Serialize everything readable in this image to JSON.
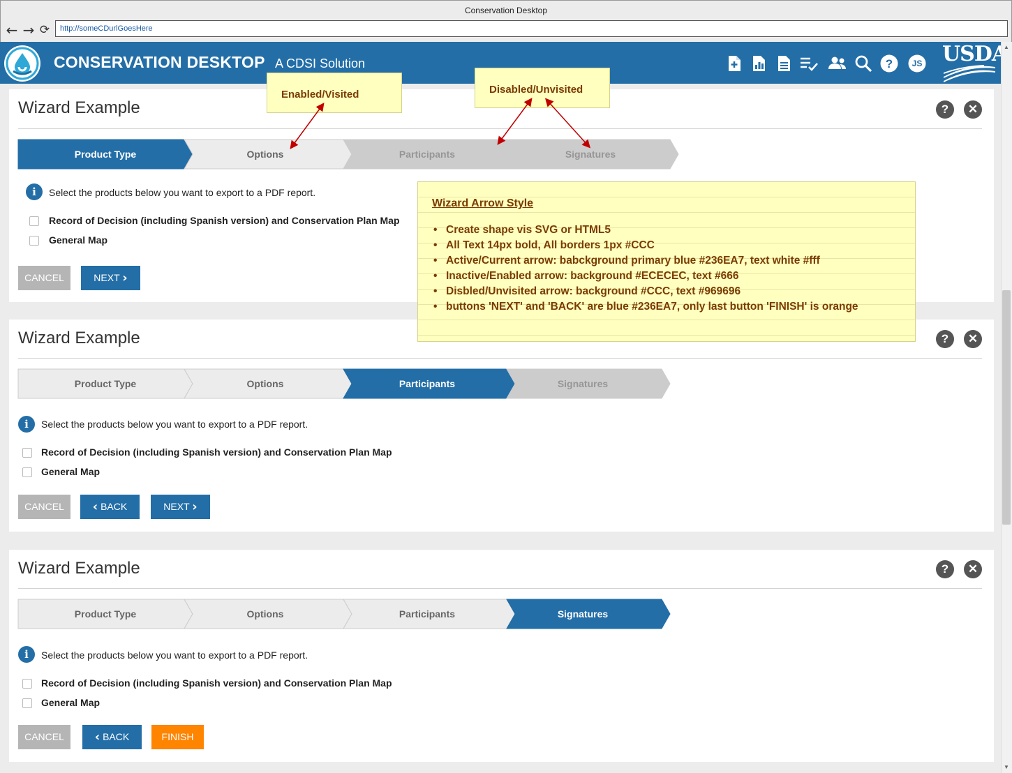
{
  "browser": {
    "window_title": "Conservation Desktop",
    "url": "http://someCDurlGoesHere"
  },
  "header": {
    "title": "CONSERVATION DESKTOP",
    "subtitle": "A CDSI Solution",
    "user_initials": "JS",
    "brand_text": "USDA",
    "icons": [
      "document-add-icon",
      "report-chart-icon",
      "document-list-icon",
      "checklist-icon",
      "people-icon",
      "search-icon",
      "help-icon",
      "user-avatar-icon"
    ]
  },
  "wizards": [
    {
      "title": "Wizard Example",
      "steps": [
        {
          "label": "Product Type",
          "state": "active"
        },
        {
          "label": "Options",
          "state": "enabled"
        },
        {
          "label": "Participants",
          "state": "disabled"
        },
        {
          "label": "Signatures",
          "state": "disabled"
        }
      ],
      "info": "Select the products below you want to export to a PDF report.",
      "options": [
        "Record of Decision (including Spanish version) and Conservation Plan Map",
        "General Map"
      ],
      "buttons": {
        "cancel": "CANCEL",
        "next": "NEXT"
      }
    },
    {
      "title": "Wizard Example",
      "steps": [
        {
          "label": "Product Type",
          "state": "enabled"
        },
        {
          "label": "Options",
          "state": "enabled"
        },
        {
          "label": "Participants",
          "state": "active"
        },
        {
          "label": "Signatures",
          "state": "disabled"
        }
      ],
      "info": "Select the products below you want to export to a PDF report.",
      "options": [
        "Record of Decision (including Spanish version) and Conservation Plan Map",
        "General Map"
      ],
      "buttons": {
        "cancel": "CANCEL",
        "back": "BACK",
        "next": "NEXT"
      }
    },
    {
      "title": "Wizard Example",
      "steps": [
        {
          "label": "Product Type",
          "state": "enabled"
        },
        {
          "label": "Options",
          "state": "enabled"
        },
        {
          "label": "Participants",
          "state": "enabled"
        },
        {
          "label": "Signatures",
          "state": "active"
        }
      ],
      "info": "Select the products below you want to export to a PDF report.",
      "options": [
        "Record of Decision (including Spanish version) and Conservation Plan Map",
        "General Map"
      ],
      "buttons": {
        "cancel": "CANCEL",
        "back": "BACK",
        "finish": "FINISH"
      }
    }
  ],
  "notes": {
    "enabled": "Enabled/Visited",
    "disabled": "Disabled/Unvisited",
    "style_heading": "Wizard Arrow Style",
    "style_items": [
      "Create shape vis SVG or HTML5",
      "All Text 14px bold, All borders 1px #CCC",
      "Active/Current arrow: babckground primary blue #236EA7, text white #fff",
      "Inactive/Enabled arrow: background #ECECEC,  text #666",
      "Disbled/Unvisited arrow: background #CCC, text #969696",
      "buttons 'NEXT' and 'BACK' are blue #236EA7, only last button 'FINISH' is orange"
    ]
  },
  "colors": {
    "primary_blue": "#236ea7",
    "enabled_bg": "#ececec",
    "enabled_text": "#666666",
    "disabled_bg": "#cccccc",
    "disabled_text": "#969696",
    "finish_orange": "#ff8400",
    "border": "#cccccc"
  }
}
